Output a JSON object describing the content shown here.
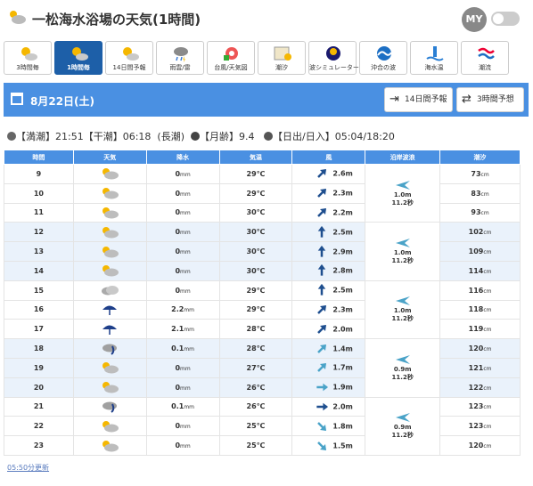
{
  "page": {
    "title": "一松海水浴場の天気(1時間)",
    "my_label": "MY"
  },
  "tabs": [
    {
      "label": "3時間毎",
      "icon": "sun-cloud-icon",
      "active": false
    },
    {
      "label": "1時間毎",
      "icon": "sun-cloud-icon",
      "active": true
    },
    {
      "label": "14日間予報",
      "icon": "sun-cloud-icon",
      "active": false
    },
    {
      "label": "雨雲/雷",
      "icon": "rain-cloud-icon",
      "active": false
    },
    {
      "label": "台風/天気図",
      "icon": "typhoon-map-icon",
      "active": false
    },
    {
      "label": "潮汐",
      "icon": "tide-icon",
      "active": false
    },
    {
      "label": "波シミュレーター",
      "icon": "wave-simulator-icon",
      "active": false
    },
    {
      "label": "沖合の波",
      "icon": "offshore-wave-icon",
      "active": false
    },
    {
      "label": "海水温",
      "icon": "sea-temp-icon",
      "active": false
    },
    {
      "label": "潮流",
      "icon": "tidal-current-icon",
      "active": false
    }
  ],
  "datebar": {
    "date": "8月22日(土)",
    "btn_14day": "14日間予報",
    "btn_3hour": "3時間予想"
  },
  "info": {
    "high_tide_label": "【満潮】",
    "high_tide": "21:51",
    "low_tide_label": "【干潮】",
    "low_tide": "06:18",
    "tide_type": "(長潮)",
    "moon_age_label": "【月齢】",
    "moon_age": "9.4",
    "sun_label": "【日出/日入】",
    "sun": "05:04/18:20"
  },
  "table": {
    "headers": [
      "時間",
      "天気",
      "降水",
      "気温",
      "風",
      "沿岸波浪",
      "潮汐"
    ],
    "rows": [
      {
        "hour": "9",
        "weather": "cloudy-sun-icon",
        "rain": "0",
        "temp": "29℃",
        "wind_dir": "ne",
        "wind": "2.6m",
        "tide": "73"
      },
      {
        "hour": "10",
        "weather": "cloudy-sun-icon",
        "rain": "0",
        "temp": "29℃",
        "wind_dir": "ne",
        "wind": "2.3m",
        "tide": "83"
      },
      {
        "hour": "11",
        "weather": "cloudy-sun-icon",
        "rain": "0",
        "temp": "30℃",
        "wind_dir": "ne",
        "wind": "2.2m",
        "tide": "93"
      },
      {
        "hour": "12",
        "weather": "cloudy-sun-icon",
        "rain": "0",
        "temp": "30℃",
        "wind_dir": "n",
        "wind": "2.5m",
        "tide": "102"
      },
      {
        "hour": "13",
        "weather": "cloudy-sun-icon",
        "rain": "0",
        "temp": "30℃",
        "wind_dir": "n",
        "wind": "2.9m",
        "tide": "109"
      },
      {
        "hour": "14",
        "weather": "cloudy-sun-icon",
        "rain": "0",
        "temp": "30℃",
        "wind_dir": "n",
        "wind": "2.8m",
        "tide": "114"
      },
      {
        "hour": "15",
        "weather": "cloudy-icon",
        "rain": "0",
        "temp": "29℃",
        "wind_dir": "n",
        "wind": "2.5m",
        "tide": "116"
      },
      {
        "hour": "16",
        "weather": "umbrella-icon",
        "rain": "2.2",
        "temp": "29℃",
        "wind_dir": "ne",
        "wind": "2.3m",
        "tide": "118"
      },
      {
        "hour": "17",
        "weather": "umbrella-icon",
        "rain": "2.1",
        "temp": "28℃",
        "wind_dir": "ne",
        "wind": "2.0m",
        "tide": "119"
      },
      {
        "hour": "18",
        "weather": "rain-cloud-icon",
        "rain": "0.1",
        "temp": "28℃",
        "wind_dir": "ne-light",
        "wind": "1.4m",
        "tide": "120"
      },
      {
        "hour": "19",
        "weather": "cloudy-sun-icon",
        "rain": "0",
        "temp": "27℃",
        "wind_dir": "ne-light",
        "wind": "1.7m",
        "tide": "121"
      },
      {
        "hour": "20",
        "weather": "cloudy-sun-icon",
        "rain": "0",
        "temp": "26℃",
        "wind_dir": "e-light",
        "wind": "1.9m",
        "tide": "122"
      },
      {
        "hour": "21",
        "weather": "rain-cloud-icon",
        "rain": "0.1",
        "temp": "26℃",
        "wind_dir": "e",
        "wind": "2.0m",
        "tide": "123"
      },
      {
        "hour": "22",
        "weather": "cloudy-sun-icon",
        "rain": "0",
        "temp": "25℃",
        "wind_dir": "se-light",
        "wind": "1.8m",
        "tide": "123"
      },
      {
        "hour": "23",
        "weather": "cloudy-sun-icon",
        "rain": "0",
        "temp": "25℃",
        "wind_dir": "se-light",
        "wind": "1.5m",
        "tide": "120"
      }
    ],
    "rain_unit": "mm",
    "tide_unit": "cm",
    "waves": [
      {
        "height": "1.0m",
        "period": "11.2秒"
      },
      {
        "height": "1.0m",
        "period": "11.2秒"
      },
      {
        "height": "1.0m",
        "period": "11.2秒"
      },
      {
        "height": "0.9m",
        "period": "11.2秒"
      },
      {
        "height": "0.9m",
        "period": "11.2秒"
      }
    ]
  },
  "footer": {
    "updated": "05:50分更新"
  },
  "colors": {
    "brand_blue": "#4a90e2",
    "active_tab": "#1d5fa8",
    "row_alt": "#eaf2fb",
    "wind_dark": "#1f4f8f",
    "wind_light": "#4aa3c8"
  }
}
